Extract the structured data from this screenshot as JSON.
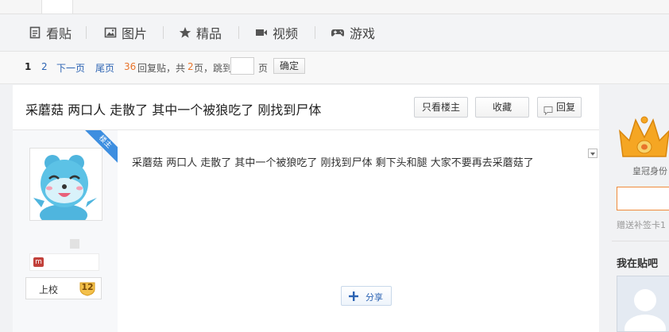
{
  "nav": {
    "items": [
      {
        "label": "看贴",
        "icon": "document-icon"
      },
      {
        "label": "图片",
        "icon": "image-icon"
      },
      {
        "label": "精品",
        "icon": "star-icon"
      },
      {
        "label": "视频",
        "icon": "video-camera-icon"
      },
      {
        "label": "游戏",
        "icon": "gamepad-icon"
      }
    ]
  },
  "pager": {
    "current_page": "1",
    "page_2": "2",
    "next": "下一页",
    "last": "尾页",
    "reply_count": "36",
    "reply_text": "回复贴，共",
    "total_pages": "2",
    "pages_jump_text": "页，跳到",
    "page_unit": "页",
    "confirm": "确定"
  },
  "thread": {
    "title": "采蘑菇 两口人 走散了 其中一个被狼吃了 刚找到尸体",
    "only_op_button": "只看楼主",
    "favorite_button": "收藏",
    "reply_button": "回复"
  },
  "post": {
    "op_badge": "楼主",
    "content": "采蘑菇 两口人 走散了 其中一个被狼吃了 刚找到尸体 剩下头和腿 大家不要再去采蘑菇了",
    "share_button": "分享",
    "user_level_label": "上校",
    "user_level_number": "12"
  },
  "sidebar": {
    "crown_label": "皇冠身份",
    "sign_note": "赠送补签卡1",
    "my_in_bar": "我在贴吧"
  },
  "colors": {
    "link": "#2d64b3",
    "reply_count": "#e8742b",
    "op_ribbon": "#3d8ee0",
    "crown_gold": "#f5a623",
    "input_border_orange": "#f08a3b"
  }
}
